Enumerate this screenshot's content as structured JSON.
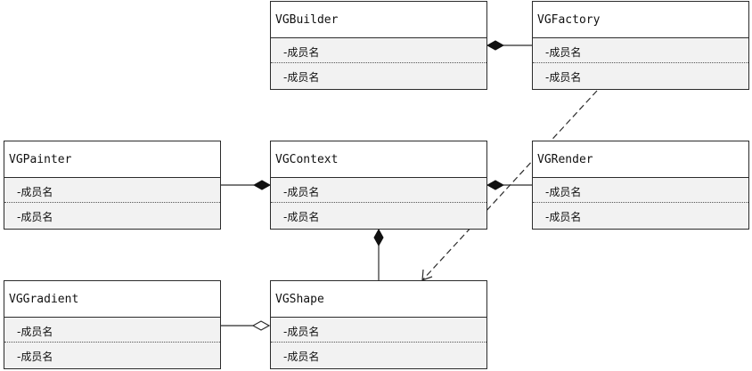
{
  "diagram": {
    "classes": [
      {
        "id": "vgbuilder",
        "name": "VGBuilder",
        "members": [
          "-成员名",
          "-成员名"
        ]
      },
      {
        "id": "vgfactory",
        "name": "VGFactory",
        "members": [
          "-成员名",
          "-成员名"
        ]
      },
      {
        "id": "vgpainter",
        "name": "VGPainter",
        "members": [
          "-成员名",
          "-成员名"
        ]
      },
      {
        "id": "vgcontext",
        "name": "VGContext",
        "members": [
          "-成员名",
          "-成员名"
        ]
      },
      {
        "id": "vgrender",
        "name": "VGRender",
        "members": [
          "-成员名",
          "-成员名"
        ]
      },
      {
        "id": "vggradient",
        "name": "VGGradient",
        "members": [
          "-成员名",
          "-成员名"
        ]
      },
      {
        "id": "vgshape",
        "name": "VGShape",
        "members": [
          "-成员名",
          "-成员名"
        ]
      }
    ],
    "relations": [
      {
        "from": "vgfactory",
        "to": "vgbuilder",
        "kind": "composition"
      },
      {
        "from": "vgpainter",
        "to": "vgcontext",
        "kind": "composition"
      },
      {
        "from": "vgrender",
        "to": "vgcontext",
        "kind": "composition"
      },
      {
        "from": "vgshape",
        "to": "vgcontext",
        "kind": "composition"
      },
      {
        "from": "vggradient",
        "to": "vgshape",
        "kind": "aggregation"
      },
      {
        "from": "vgfactory",
        "to": "vgshape",
        "kind": "dependency"
      }
    ]
  },
  "colors": {
    "border": "#2b2b2b",
    "member_background": "#f2f2f2",
    "name_background": "#ffffff",
    "line": "#2b2b2b"
  }
}
